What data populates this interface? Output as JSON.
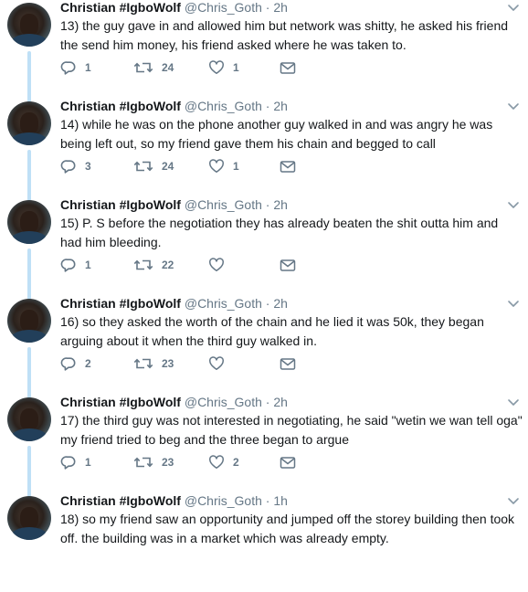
{
  "tweets": [
    {
      "name": "Christian #IgboWolf",
      "handle": "@Chris_Goth",
      "dot": "·",
      "time": "2h",
      "text": "13) the guy gave in and allowed him but network was shitty, he asked his friend the send him money, his friend asked where he was taken to.",
      "replies": "1",
      "retweets": "24",
      "likes": "1"
    },
    {
      "name": "Christian #IgboWolf",
      "handle": "@Chris_Goth",
      "dot": "·",
      "time": "2h",
      "text": "14) while he was on the phone another guy walked in and was angry he was being left out, so my friend gave them his chain and begged to call",
      "replies": "3",
      "retweets": "24",
      "likes": "1"
    },
    {
      "name": "Christian #IgboWolf",
      "handle": "@Chris_Goth",
      "dot": "·",
      "time": "2h",
      "text": "15) P. S before the negotiation they has already beaten the shit outta him and had him bleeding.",
      "replies": "1",
      "retweets": "22",
      "likes": ""
    },
    {
      "name": "Christian #IgboWolf",
      "handle": "@Chris_Goth",
      "dot": "·",
      "time": "2h",
      "text": "16) so they asked the worth of the chain and he lied it was 50k, they began arguing about it when the third guy walked in.",
      "replies": "2",
      "retweets": "23",
      "likes": ""
    },
    {
      "name": "Christian #IgboWolf",
      "handle": "@Chris_Goth",
      "dot": "·",
      "time": "2h",
      "text": "17) the third guy was not interested in negotiating, he said \"wetin we wan tell oga\" my friend tried to beg and the three began to argue",
      "replies": "1",
      "retweets": "23",
      "likes": "2"
    },
    {
      "name": "Christian #IgboWolf",
      "handle": "@Chris_Goth",
      "dot": "·",
      "time": "1h",
      "text": "18) so my friend saw an opportunity and jumped off the storey building then took off. the building was in a market which was already empty.",
      "replies": "",
      "retweets": "",
      "likes": ""
    }
  ],
  "colors": {
    "thread_line": "#bfe0f6",
    "secondary_text": "#657786",
    "primary_text": "#14171a"
  },
  "icons": [
    "reply-icon",
    "retweet-icon",
    "like-icon",
    "direct-message-icon",
    "chevron-down-icon"
  ]
}
